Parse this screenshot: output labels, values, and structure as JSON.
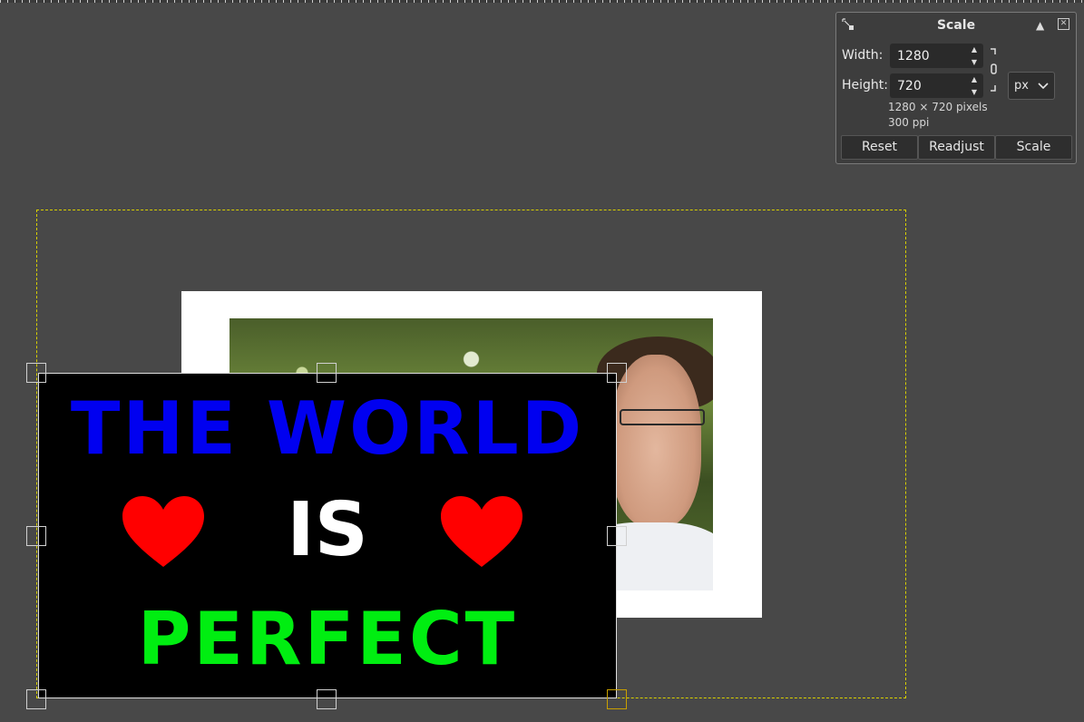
{
  "poster": {
    "line1": "THE WORLD",
    "line2": "IS",
    "line3": "PERFECT",
    "colors": {
      "line1": "#0000f0",
      "line2": "#ffffff",
      "line3": "#00ee11",
      "heart": "#ff0000",
      "background": "#000000"
    }
  },
  "scale_dialog": {
    "title": "Scale",
    "width_label": "Width:",
    "width_value": "1280",
    "height_label": "Height:",
    "height_value": "720",
    "unit": "px",
    "size_info": "1280 × 720 pixels",
    "resolution_info": "300 ppi",
    "buttons": {
      "reset": "Reset",
      "readjust": "Readjust",
      "scale": "Scale"
    },
    "icons": {
      "tool": "scale-tool-icon",
      "detach": "detach-icon",
      "close": "close-icon",
      "chain": "chain-link-icon"
    }
  }
}
